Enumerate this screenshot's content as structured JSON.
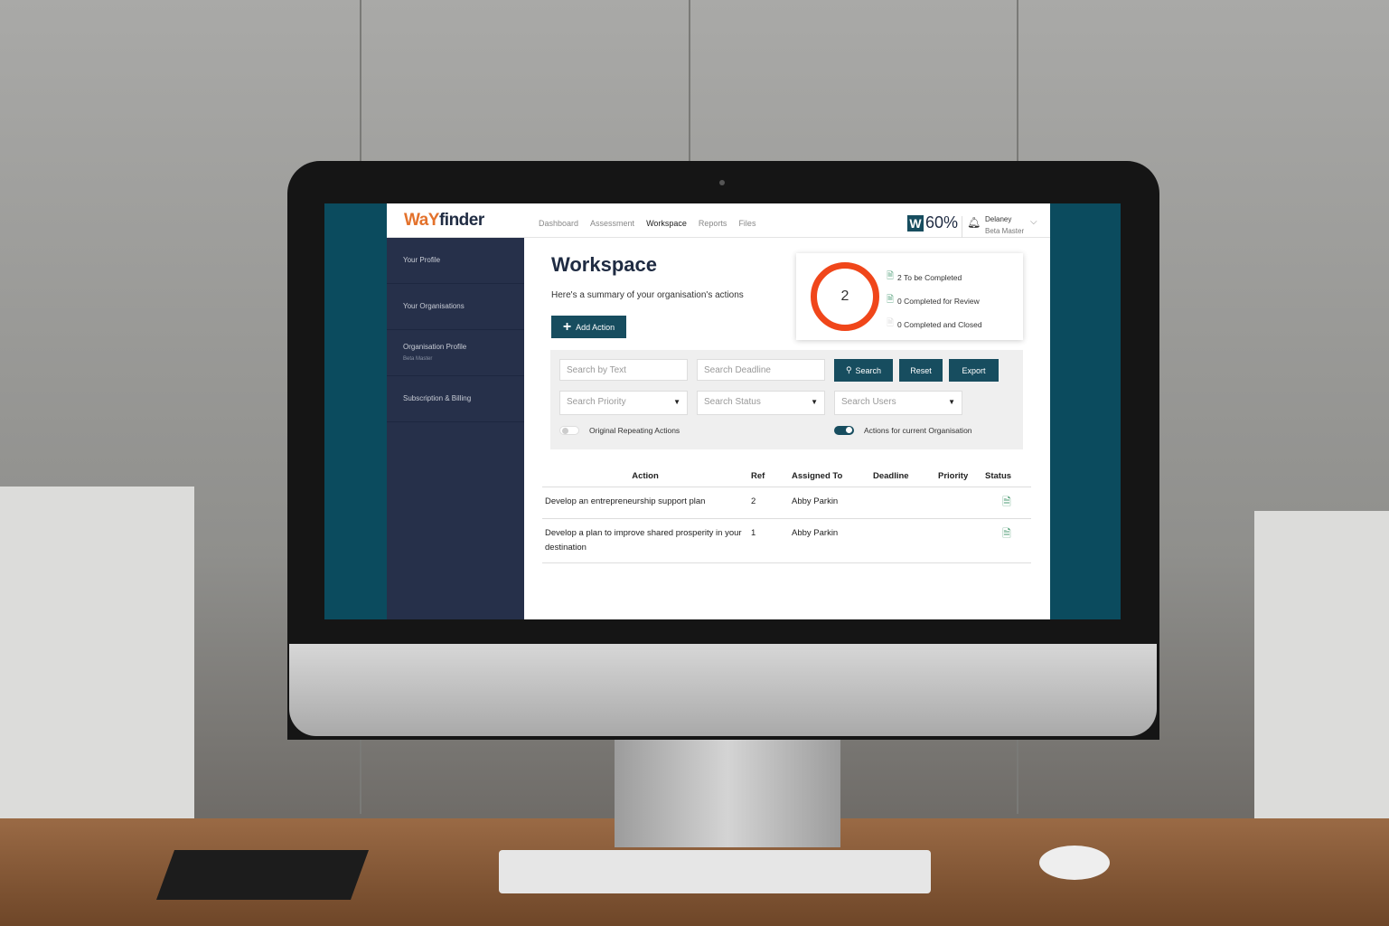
{
  "header": {
    "logo_a": "WaY",
    "logo_b": "finder",
    "nav": [
      "Dashboard",
      "Assessment",
      "Workspace",
      "Reports",
      "Files"
    ],
    "active_nav": "Workspace",
    "badge_letter": "W",
    "score": "60%",
    "user_name": "Delaney",
    "user_role": "Beta Master"
  },
  "sidebar": {
    "items": [
      {
        "label": "Your Profile"
      },
      {
        "label": "Your Organisations"
      },
      {
        "label": "Organisation Profile",
        "sub": "Beta Master"
      },
      {
        "label": "Subscription & Billing"
      }
    ]
  },
  "main": {
    "title": "Workspace",
    "subtitle": "Here's a summary of your organisation's actions",
    "add_action": "Add Action"
  },
  "summary": {
    "count": "2",
    "stats": [
      "2 To be Completed",
      "0 Completed for Review",
      "0 Completed and Closed"
    ],
    "ring_color": "#f0461a"
  },
  "filters": {
    "text_placeholder": "Search by Text",
    "deadline_placeholder": "Search Deadline",
    "priority": "Search Priority",
    "status": "Search Status",
    "users": "Search Users",
    "search": "Search",
    "reset": "Reset",
    "export": "Export",
    "toggle1_label": "Original Repeating Actions",
    "toggle1_on": false,
    "toggle2_label": "Actions for current Organisation",
    "toggle2_on": true
  },
  "table": {
    "columns": [
      "Action",
      "Ref",
      "Assigned To",
      "Deadline",
      "Priority",
      "Status"
    ],
    "rows": [
      {
        "action": "Develop an entrepreneurship support plan",
        "ref": "2",
        "assigned": "Abby Parkin",
        "deadline": "",
        "priority": "",
        "status": "to-be-completed-icon"
      },
      {
        "action": "Develop a plan to improve shared prosperity in your destination",
        "ref": "1",
        "assigned": "Abby Parkin",
        "deadline": "",
        "priority": "",
        "status": "to-be-completed-icon"
      }
    ]
  },
  "colors": {
    "primary": "#174d5f",
    "sidebar": "#26304a",
    "accent": "#e3722c"
  }
}
